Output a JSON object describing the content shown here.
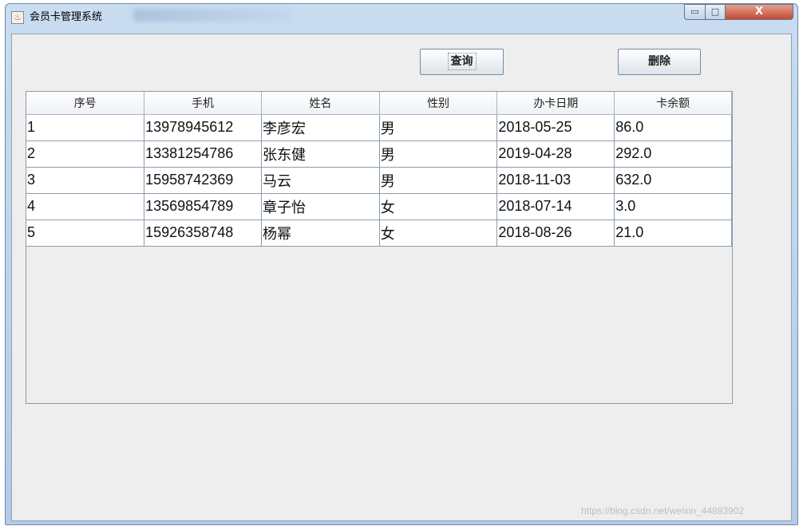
{
  "window": {
    "title": "会员卡管理系统",
    "controls": {
      "minimize": "▭",
      "maximize": "□",
      "close": "X"
    }
  },
  "toolbar": {
    "query_label": "查询",
    "delete_label": "删除"
  },
  "table": {
    "columns": [
      "序号",
      "手机",
      "姓名",
      "性别",
      "办卡日期",
      "卡余额"
    ],
    "rows": [
      [
        "1",
        "13978945612",
        "李彦宏",
        "男",
        "2018-05-25",
        "86.0"
      ],
      [
        "2",
        "13381254786",
        "张东健",
        "男",
        "2019-04-28",
        "292.0"
      ],
      [
        "3",
        "15958742369",
        "马云",
        "男",
        "2018-11-03",
        "632.0"
      ],
      [
        "4",
        "13569854789",
        "章子怡",
        "女",
        "2018-07-14",
        "3.0"
      ],
      [
        "5",
        "15926358748",
        "杨幂",
        "女",
        "2018-08-26",
        "21.0"
      ]
    ]
  },
  "watermark": "https://blog.csdn.net/weixin_44893902"
}
